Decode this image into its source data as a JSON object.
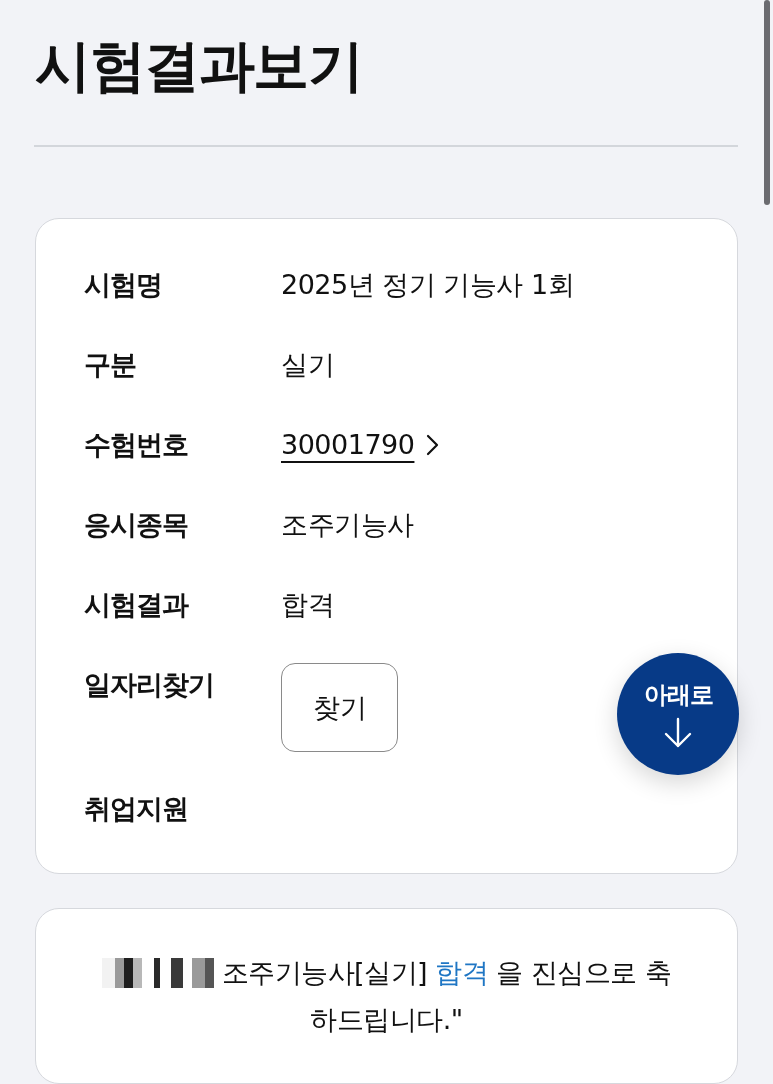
{
  "page": {
    "title": "시험결과보기"
  },
  "result_card": {
    "rows": [
      {
        "kind": "text",
        "label": "시험명",
        "value": "2025년 정기 기능사 1회"
      },
      {
        "kind": "text",
        "label": "구분",
        "value": "실기"
      },
      {
        "kind": "link",
        "label": "수험번호",
        "value": "30001790"
      },
      {
        "kind": "text",
        "label": "응시종목",
        "value": "조주기능사"
      },
      {
        "kind": "text",
        "label": "시험결과",
        "value": "합격"
      },
      {
        "kind": "button",
        "label": "일자리찾기",
        "value": "찾기"
      },
      {
        "kind": "empty",
        "label": "취업지원"
      }
    ]
  },
  "scroll_button": {
    "label": "아래로"
  },
  "message_card": {
    "before": "조주기능사[실기]",
    "highlight": "합격",
    "after": "을 진심으로 축하드립니다.\""
  }
}
